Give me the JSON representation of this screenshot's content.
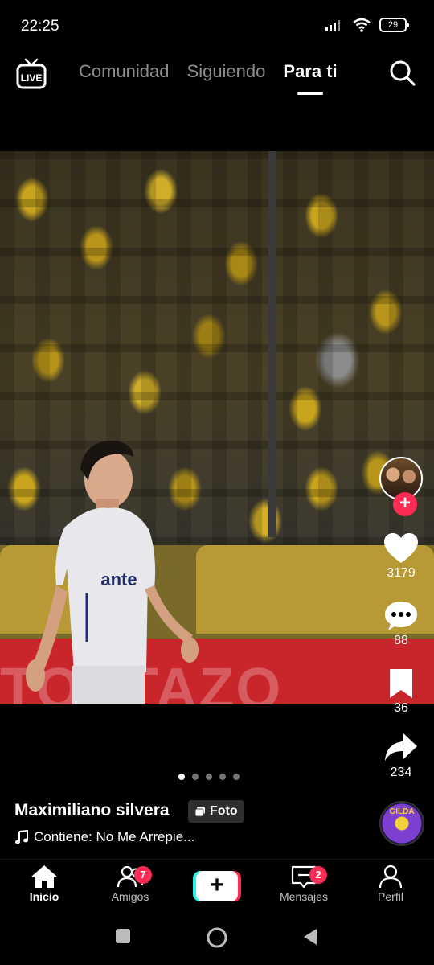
{
  "status_bar": {
    "time": "22:25",
    "battery": "29",
    "icons": [
      "signal-icon",
      "wifi-icon",
      "battery-icon"
    ]
  },
  "top_nav": {
    "live_icon_text": "LIVE",
    "tabs": [
      {
        "label": "Comunidad",
        "active": false
      },
      {
        "label": "Siguiendo",
        "active": false
      },
      {
        "label": "Para ti",
        "active": true
      }
    ],
    "search_icon": "search-icon"
  },
  "post": {
    "banner_text": "TOSTAZO",
    "slides_total": 5,
    "slides_active_index": 0,
    "username": "Maximiliano silvera",
    "media_badge": "Foto",
    "sound": "Contiene: No Me Arrepie...",
    "music_disc_label": "GILDA"
  },
  "actions": {
    "likes": "3179",
    "comments": "88",
    "saves": "36",
    "shares": "234"
  },
  "bottom_nav": {
    "items": [
      {
        "label": "Inicio",
        "active": true,
        "icon": "home-icon"
      },
      {
        "label": "Amigos",
        "active": false,
        "icon": "friends-icon",
        "badge": "7"
      },
      {
        "label": "",
        "icon": "create-icon"
      },
      {
        "label": "Mensajes",
        "active": false,
        "icon": "inbox-icon",
        "badge": "2"
      },
      {
        "label": "Perfil",
        "active": false,
        "icon": "profile-icon"
      }
    ]
  },
  "colors": {
    "accent": "#fe2c55",
    "cyan": "#25f4ee",
    "background": "#000000"
  }
}
